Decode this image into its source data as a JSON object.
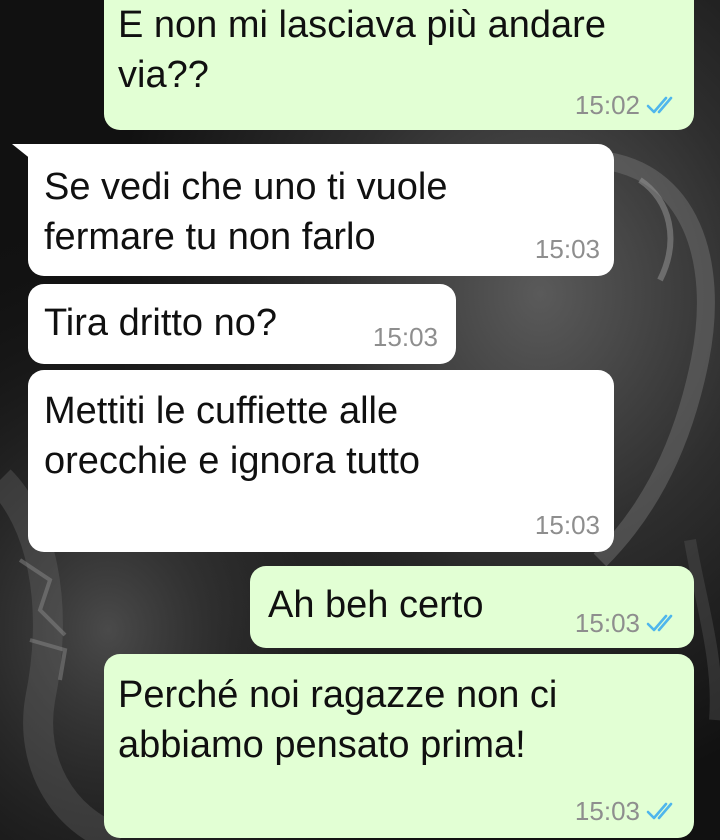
{
  "theme": {
    "outgoing_bubble": "#e2ffd4",
    "incoming_bubble": "#ffffff",
    "timestamp_color": "#8e8e8e",
    "read_tick_color": "#4fb6ec"
  },
  "messages": [
    {
      "direction": "outgoing",
      "text": "E non mi lasciava più andare\nvia??",
      "time": "15:02",
      "status": "read",
      "status_icon": "double-check-icon"
    },
    {
      "direction": "incoming",
      "text": "Se vedi che uno ti vuole\nfermare tu non farlo",
      "time": "15:03"
    },
    {
      "direction": "incoming",
      "text": "Tira dritto no?",
      "time": "15:03"
    },
    {
      "direction": "incoming",
      "text": "Mettiti le cuffiette alle\norecchie e ignora tutto",
      "time": "15:03"
    },
    {
      "direction": "outgoing",
      "text": "Ah beh certo",
      "time": "15:03",
      "status": "read",
      "status_icon": "double-check-icon"
    },
    {
      "direction": "outgoing",
      "text": "Perché noi ragazze non ci\nabbiamo pensato prima!",
      "time": "15:03",
      "status": "read",
      "status_icon": "double-check-icon"
    }
  ]
}
